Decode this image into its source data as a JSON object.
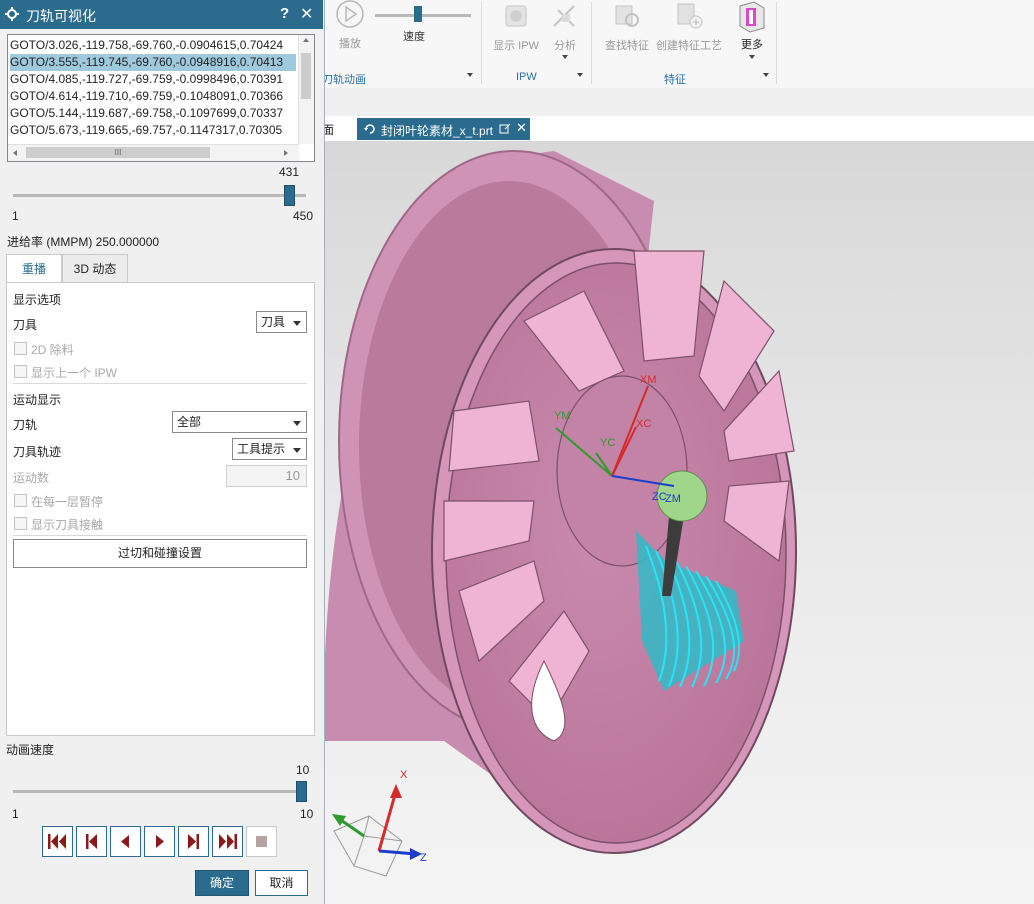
{
  "dialog": {
    "title": "刀轨可视化",
    "help": "?",
    "close": "✕",
    "list_rows": [
      "GOTO/3.026,-119.758,-69.760,-0.0904615,0.70424",
      "GOTO/3.555,-119.745,-69.760,-0.0948916,0.70413",
      "GOTO/4.085,-119.727,-69.759,-0.0998496,0.70391",
      "GOTO/4.614,-119.710,-69.759,-0.1048091,0.70366",
      "GOTO/5.144,-119.687,-69.758,-0.1097699,0.70337",
      "GOTO/5.673,-119.665,-69.757,-0.1147317,0.70305"
    ],
    "hscroll_grip": "III",
    "position_slider": {
      "current": "431",
      "min": "1",
      "max": "450",
      "fraction": 0.958
    },
    "feed_rate": "进给率 (MMPM) 250.000000",
    "tabs": [
      "重播",
      "3D 动态"
    ],
    "display_options": {
      "heading": "显示选项",
      "tool_label": "刀具",
      "tool_value": "刀具",
      "chk_2d": "2D 除料",
      "chk_prev_ipw": "显示上一个 IPW"
    },
    "motion_display": {
      "heading": "运动显示",
      "path_label": "刀轨",
      "path_value": "全部",
      "trace_label": "刀具轨迹",
      "trace_value": "工具提示",
      "count_label": "运动数",
      "count_value": "10",
      "chk_pause": "在每一层暂停",
      "chk_contact": "显示刀具接触"
    },
    "gouge_button": "过切和碰撞设置",
    "anim_speed": {
      "label": "动画速度",
      "current": "10",
      "min": "1",
      "max": "10",
      "fraction": 1.0
    },
    "ok": "确定",
    "cancel": "取消"
  },
  "ribbon": {
    "play": "播放",
    "speed": "速度",
    "group_anim": "刀轨动画",
    "show_ipw": "显示 IPW",
    "analyze": "分析",
    "group_ipw": "IPW",
    "find_feature": "查找特征",
    "create_feature_process": "创建特征工艺",
    "more": "更多",
    "group_feature": "特征"
  },
  "tabs": {
    "partial": "面",
    "file": "封闭叶轮素材_x_t.prt"
  },
  "viewport": {
    "labels": {
      "ym": "YM",
      "xm": "XM",
      "yc": "YC",
      "xc": "XC",
      "zc": "ZC",
      "zm": "ZM"
    },
    "triad": {
      "x": "X",
      "z": "Z"
    },
    "colors": {
      "part": "#d28fb6",
      "toolpath": "#27e4f4",
      "tool_holder": "#9fd68a",
      "accent": "#2b6c8e"
    }
  }
}
